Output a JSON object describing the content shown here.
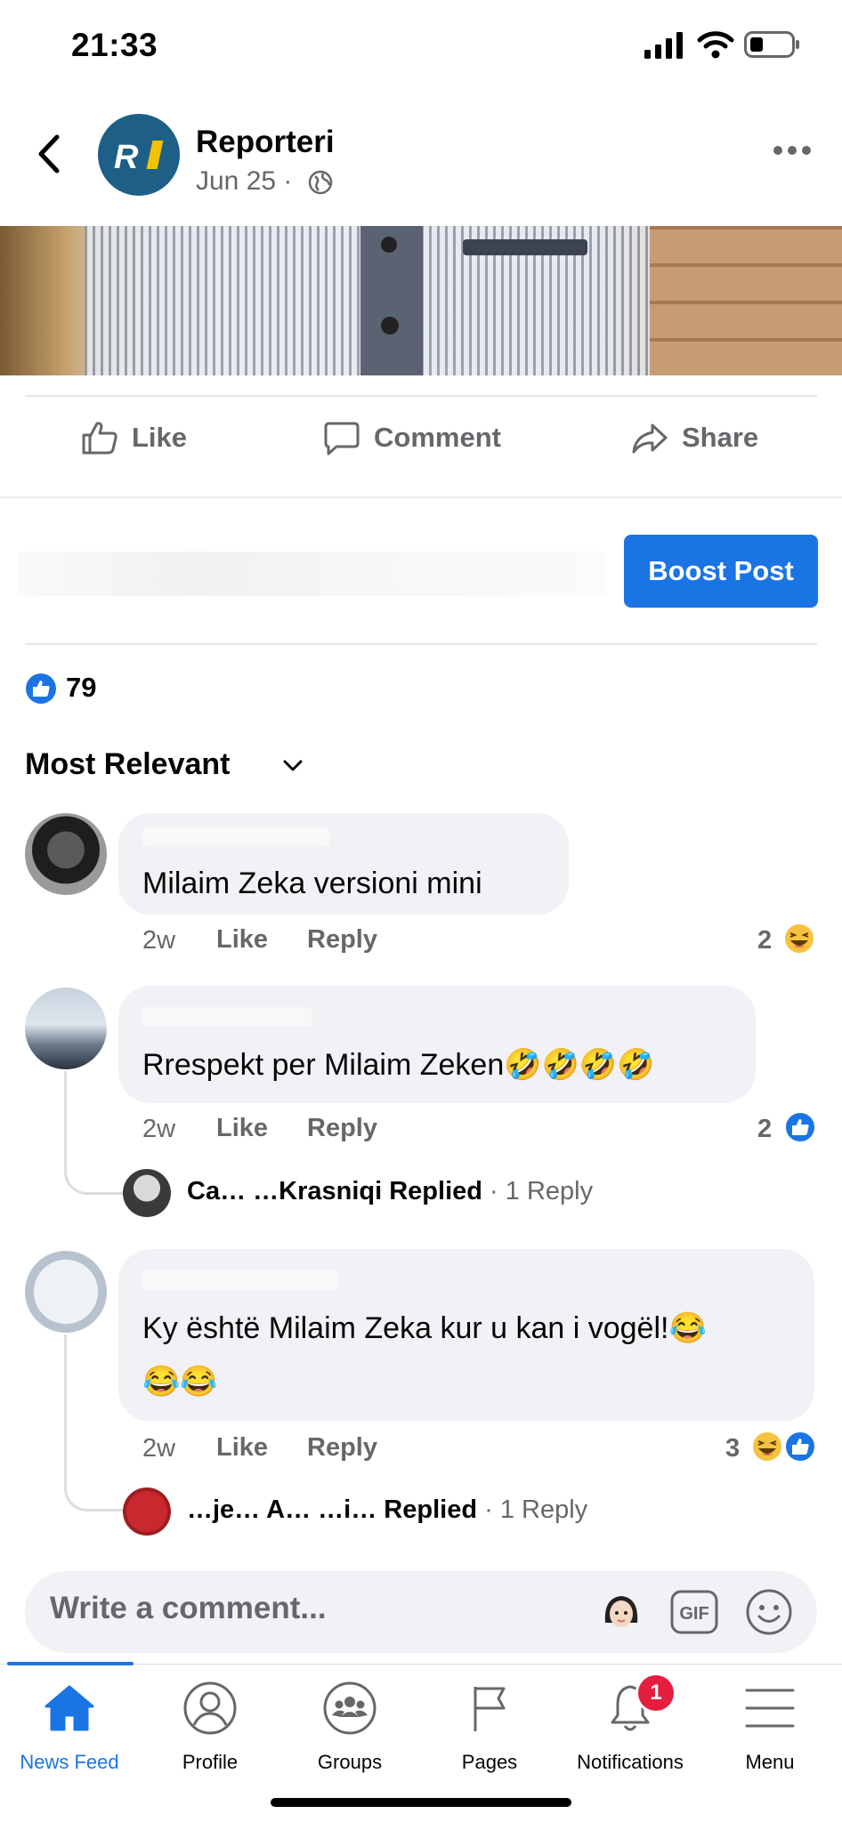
{
  "status_bar": {
    "time": "21:33"
  },
  "header": {
    "page_name": "Reporteri",
    "date": "Jun 25 ·",
    "avatar_text": "R"
  },
  "actions": {
    "like": "Like",
    "comment": "Comment",
    "share": "Share"
  },
  "boost": {
    "label": "Boost Post"
  },
  "reactions": {
    "count": "79"
  },
  "sort": {
    "label": "Most Relevant"
  },
  "comments": [
    {
      "text": "Milaim Zeka versioni  mini",
      "time": "2w",
      "like": "Like",
      "reply": "Reply",
      "reaction_count": "2"
    },
    {
      "text": "Rrespekt per Milaim Zeken🤣🤣🤣🤣",
      "time": "2w",
      "like": "Like",
      "reply": "Reply",
      "reaction_count": "2",
      "replied_name": "Ca… …Krasniqi",
      "replied_label": "Replied",
      "replied_count": "· 1 Reply"
    },
    {
      "text_line1": "Ky është Milaim Zeka kur u kan i vogël!😂",
      "text_line2": "😂😂",
      "time": "2w",
      "like": "Like",
      "reply": "Reply",
      "reaction_count": "3",
      "replied_name": "…je… A… …i…",
      "replied_label": "Replied",
      "replied_count": "· 1 Reply"
    }
  ],
  "composer": {
    "placeholder": "Write a comment..."
  },
  "tabs": [
    {
      "label": "News Feed"
    },
    {
      "label": "Profile"
    },
    {
      "label": "Groups"
    },
    {
      "label": "Pages"
    },
    {
      "label": "Notifications",
      "badge": "1"
    },
    {
      "label": "Menu"
    }
  ],
  "colors": {
    "accent": "#1b74e4",
    "badge": "#e41e3f",
    "muted_text": "#65676b",
    "bubble": "#f0f2f5"
  }
}
